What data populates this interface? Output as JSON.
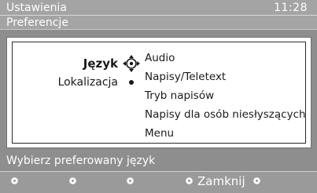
{
  "header": {
    "title": "Ustawienia",
    "clock": "11:28",
    "subtitle": "Preferencje"
  },
  "left_menu": {
    "items": [
      {
        "label": "Język",
        "selected": true,
        "icon": "navigation-pad-icon"
      },
      {
        "label": "Lokalizacja",
        "selected": false,
        "icon": "dot-icon"
      }
    ]
  },
  "right_menu": {
    "items": [
      {
        "label": "Audio"
      },
      {
        "label": "Napisy/Teletext"
      },
      {
        "label": "Tryb napisów"
      },
      {
        "label": "Napisy dla osób niesłyszących"
      },
      {
        "label": "Menu"
      }
    ]
  },
  "hint": "Wybierz preferowany język",
  "bottom_bar": {
    "close_label": "Zamknij"
  },
  "colors": {
    "background": "#8e8e8e",
    "panel": "#ffffff",
    "text_light": "#ffffff",
    "text_dark": "#1a1a1a"
  }
}
